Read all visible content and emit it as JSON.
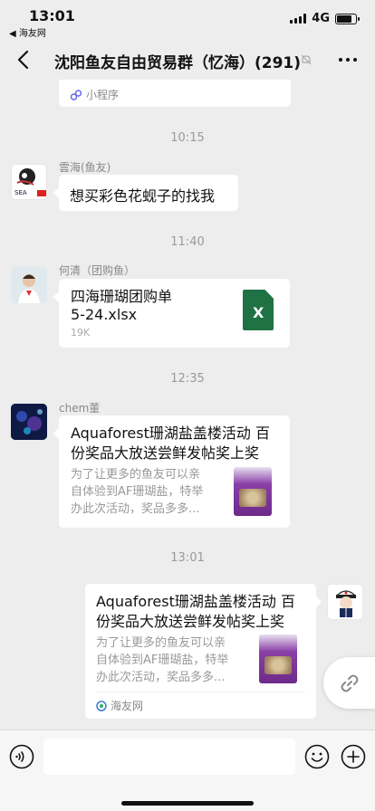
{
  "status": {
    "time": "13:01",
    "back_app": "◀ 海友网",
    "network": "4G"
  },
  "header": {
    "title": "沈阳鱼友自由贸易群（忆海）(291)"
  },
  "messages": {
    "top": {
      "miniapp_label": "小程序"
    },
    "ts1": "10:15",
    "m1": {
      "sender": "雲海(鱼友)",
      "text": "想买彩色花蚬子的找我"
    },
    "ts2": "11:40",
    "m2": {
      "sender": "何清（团购鱼）",
      "file_name_1": "四海珊瑚团购单",
      "file_name_2": "5-24.xlsx",
      "file_size": "19K",
      "file_icon": "X"
    },
    "ts3": "12:35",
    "m3": {
      "sender": "chem董",
      "title_1": "Aquaforest珊湖盐盖楼活动 百",
      "title_2": "份奖品大放送尝鲜发帖奖上奖",
      "desc_1": "为了让更多的鱼友可以亲",
      "desc_2": "自体验到AF珊瑚盐，特举",
      "desc_3": "办此次活动，奖品多多..."
    },
    "ts4": "13:01",
    "m4": {
      "title_1": "Aquaforest珊湖盐盖楼活动 百",
      "title_2": "份奖品大放送尝鲜发帖奖上奖",
      "desc_1": "为了让更多的鱼友可以亲",
      "desc_2": "自体验到AF珊瑚盐，特举",
      "desc_3": "办此次活动，奖品多多...",
      "source": "海友网"
    }
  },
  "icons": [
    "back-icon",
    "mute-icon",
    "more-icon",
    "voice-icon",
    "emoji-icon",
    "plus-icon",
    "link-icon",
    "miniapp-icon"
  ],
  "colors": {
    "bg": "#ededed",
    "excel": "#1f7244",
    "bubble": "#ffffff"
  }
}
